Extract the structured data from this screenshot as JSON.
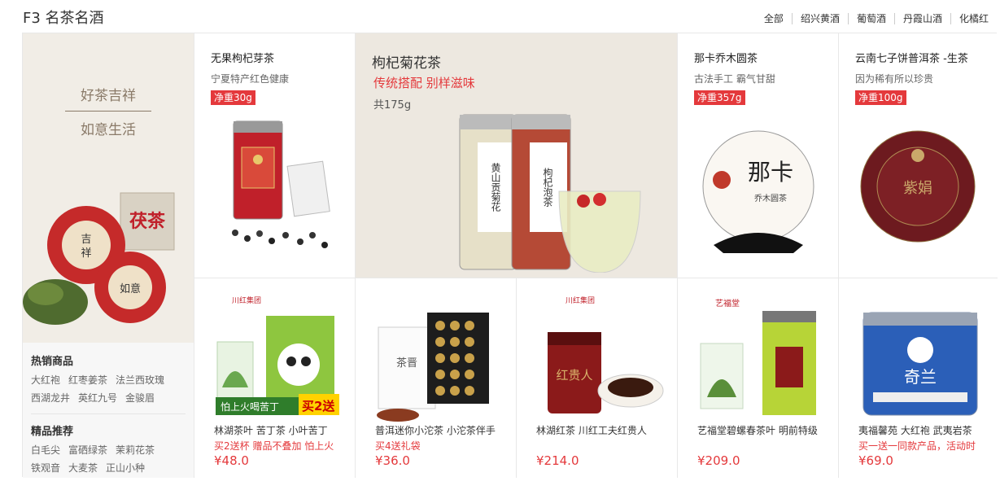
{
  "floor": {
    "title": "F3 名茶名酒",
    "tabs": [
      "全部",
      "绍兴黄酒",
      "葡萄酒",
      "丹霞山酒",
      "化橘红"
    ]
  },
  "left": {
    "banner_line1": "好茶吉祥",
    "banner_line2": "如意生活",
    "hot_title": "热销商品",
    "hot_items": [
      "大红袍",
      "红枣姜茶",
      "法兰西玫瑰",
      "西湖龙井",
      "英红九号",
      "金骏眉"
    ],
    "pick_title": "精品推荐",
    "pick_items": [
      "白毛尖",
      "富硒绿茶",
      "茉莉花茶",
      "铁观音",
      "大麦茶",
      "正山小种"
    ]
  },
  "top": {
    "p1": {
      "name": "无果枸杞芽茶",
      "sub": "宁夏特产红色健康",
      "tag": "净重30g"
    },
    "featured": {
      "name": "枸杞菊花茶",
      "promo": "传统搭配 别样滋味",
      "weight": "共175g"
    },
    "p3": {
      "name": "那卡乔木圆茶",
      "sub": "古法手工 霸气甘甜",
      "tag": "净重357g"
    },
    "p4": {
      "name": "云南七子饼普洱茶 -生茶",
      "sub": "因为稀有所以珍贵",
      "tag": "净重100g"
    }
  },
  "bottom": [
    {
      "name": "林湖茶叶 苦丁茶 小叶苦丁",
      "promo": "买2送杯 赠品不叠加 怕上火",
      "price": "¥48.0",
      "label1": "怕上火喝苦丁",
      "label2": "买2送"
    },
    {
      "name": "普洱迷你小沱茶 小沱茶伴手",
      "promo": "买4送礼袋",
      "price": "¥36.0"
    },
    {
      "name": "林湖红茶 川红工夫红贵人",
      "promo": "",
      "price": "¥214.0"
    },
    {
      "name": "艺福堂碧螺春茶叶 明前特级",
      "promo": "",
      "price": "¥209.0"
    },
    {
      "name": "夷福馨苑 大红袍 武夷岩茶",
      "promo": "买一送一同款产品，活动时",
      "price": "¥69.0"
    }
  ],
  "colors": {
    "accent": "#e4393c",
    "banner_bg": "#f1ede6",
    "featured_bg": "#ede8e0"
  },
  "icons": [
    "tea-tin-icon",
    "tea-cake-icon",
    "jar-icon",
    "glass-cup-icon"
  ]
}
